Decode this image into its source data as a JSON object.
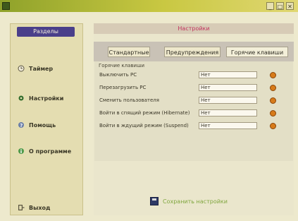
{
  "titlebar": {
    "title": "",
    "min": "_",
    "max": "□",
    "close": "✕"
  },
  "sidebar": {
    "header": "Разделы",
    "items": [
      {
        "label": "Таймер",
        "icon": "clock-icon"
      },
      {
        "label": "Настройки",
        "icon": "gear-icon"
      },
      {
        "label": "Помощь",
        "icon": "help-icon"
      },
      {
        "label": "О программе",
        "icon": "info-icon"
      },
      {
        "label": "Выход",
        "icon": "exit-icon"
      }
    ]
  },
  "main": {
    "header": "Настройки",
    "tabs": [
      {
        "label": "Стандартные",
        "active": false
      },
      {
        "label": "Предупреждения",
        "active": false
      },
      {
        "label": "Горячие клавиши",
        "active": true
      }
    ],
    "group_label": "Горячие клавиши",
    "rows": [
      {
        "label": "Выключить PC",
        "value": "Нет"
      },
      {
        "label": "Перезагрузить PC",
        "value": "Нет"
      },
      {
        "label": "Сменить пользователя",
        "value": "Нет"
      },
      {
        "label": "Войти в спящий режим (Hibernate)",
        "value": "Нет"
      },
      {
        "label": "Войти в ждущий режим (Suspend)",
        "value": "Нет"
      }
    ],
    "save_label": "Сохранить настройки"
  },
  "colors": {
    "accent": "#4a3f8a",
    "header_text": "#c2325d",
    "save_text": "#7fa63e",
    "row_button": "#d77b1a"
  }
}
